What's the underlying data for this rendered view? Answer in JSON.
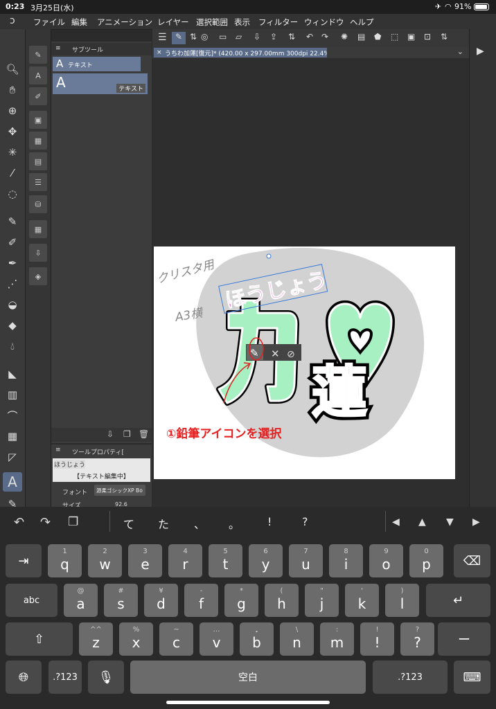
{
  "status": {
    "time": "0:23",
    "date": "3月25日(水)",
    "battery": "91%"
  },
  "menu": [
    "ファイル",
    "編集",
    "アニメーション",
    "レイヤー",
    "選択範囲",
    "表示",
    "フィルター",
    "ウィンドウ",
    "ヘルプ"
  ],
  "subtool": {
    "tab": "サブツール",
    "item1": "テキスト",
    "item2": "テキスト"
  },
  "toolprop": {
    "tab": "ツールプロパティ[",
    "preview_text": "ほうじょう",
    "editing": "【テキスト編集中】",
    "font_label": "フォント",
    "font_value": "源柔ゴシックXP Bo",
    "size_label": "サイズ",
    "size_value": "92.6"
  },
  "canvas": {
    "tab_title": "うちわ加蓮[復元]* (420.00 x 297.00mm 300dpi 22.4%)",
    "handwritten_line1": "クリスタ用",
    "handwritten_line2": "A3横",
    "pink_text": "ほうじょう",
    "big_char1": "カ",
    "big_char2": "蓮",
    "annotation": "①鉛筆アイコンを選択"
  },
  "candidates": [
    "て",
    "た",
    "、",
    "。",
    "!",
    "?"
  ],
  "keyboard": {
    "row1": [
      [
        "1",
        "q"
      ],
      [
        "2",
        "w"
      ],
      [
        "3",
        "e"
      ],
      [
        "4",
        "r"
      ],
      [
        "5",
        "t"
      ],
      [
        "6",
        "y"
      ],
      [
        "7",
        "u"
      ],
      [
        "8",
        "i"
      ],
      [
        "9",
        "o"
      ],
      [
        "0",
        "p"
      ]
    ],
    "row2": [
      [
        "@",
        "a"
      ],
      [
        "#",
        "s"
      ],
      [
        "¥",
        "d"
      ],
      [
        "-",
        "f"
      ],
      [
        "*",
        "g"
      ],
      [
        "(",
        "h"
      ],
      [
        "\"",
        "j"
      ],
      [
        "'",
        "k"
      ],
      [
        ")",
        "l"
      ]
    ],
    "row3": [
      [
        "^^",
        "z"
      ],
      [
        "%",
        "x"
      ],
      [
        "~",
        "c"
      ],
      [
        "…",
        "v"
      ],
      [
        "・",
        "b"
      ],
      [
        "\\",
        "n"
      ],
      [
        ":",
        "m"
      ],
      [
        "!",
        "!"
      ],
      [
        "?",
        "?"
      ]
    ],
    "abc": "abc",
    "numkey": ".?123",
    "space": "空白",
    "dash": "ー"
  },
  "colors": {
    "accent_green": "#a6f0c2",
    "pink": "#f36fc6",
    "annotation_red": "#e52020",
    "selected_tool": "#5a6b8a"
  }
}
